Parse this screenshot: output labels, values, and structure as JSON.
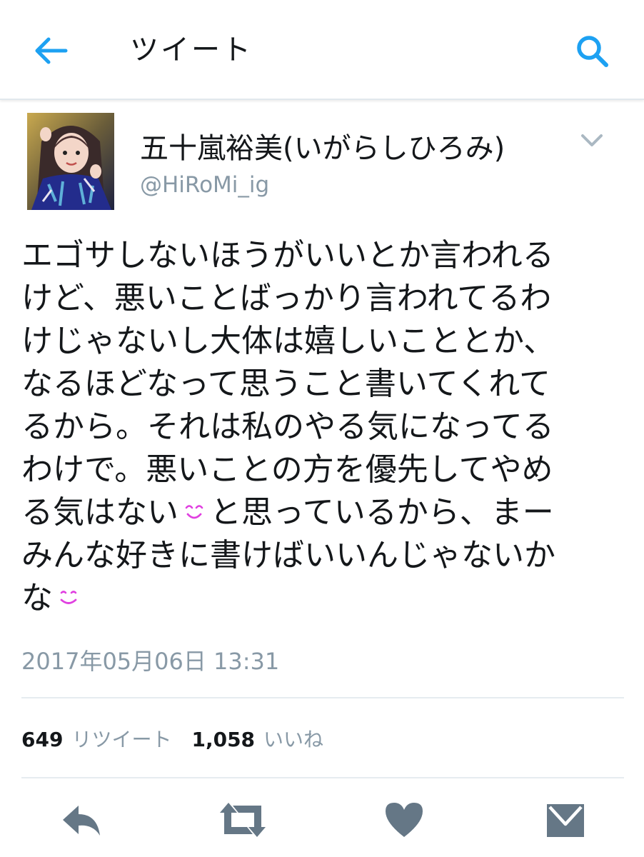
{
  "topbar": {
    "title": "ツイート",
    "back_icon": "arrow-left-icon",
    "search_icon": "search-icon"
  },
  "author": {
    "display_name": "五十嵐裕美(いがらしひろみ)",
    "handle": "@HiRoMi_ig",
    "avatar": "avatar-photo"
  },
  "tweet": {
    "lines": [
      "エゴサしないほうがいいとか言われる",
      "けど、悪いことばっかり言われてるわ",
      "けじゃないし大体は嬉しいこととか、",
      "なるほどなって思うこと書いてくれて",
      "るから。それは私のやる気になってる",
      "わけで。悪いことの方を優先してやめ",
      "る気はない",
      "と思っているから、まー",
      "みんな好きに書けばいいんじゃないか",
      "な"
    ],
    "emoji_1": "smiling-face-emoji",
    "emoji_2": "smiling-face-emoji",
    "timestamp": "2017年05月06日 13:31"
  },
  "stats": {
    "retweet_count": "649",
    "retweet_label": "リツイート",
    "like_count": "1,058",
    "like_label": "いいね"
  },
  "actions": {
    "reply_icon": "reply-icon",
    "retweet_icon": "retweet-icon",
    "like_icon": "heart-icon",
    "dm_icon": "envelope-icon"
  },
  "colors": {
    "accent": "#1da1f2",
    "icon_gray": "#657786",
    "secondary_text": "#8899a6",
    "emoji_pink": "#e040e0"
  }
}
